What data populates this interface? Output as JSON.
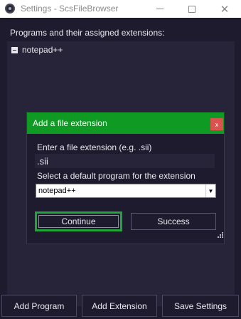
{
  "window": {
    "title": "Settings - ScsFileBrowser",
    "minimize_icon": "minimize-icon",
    "maximize_icon": "maximize-icon",
    "close_symbol": "✕"
  },
  "programs": {
    "section_label": "Programs and their assigned extensions:",
    "items": [
      {
        "label": "notepad++",
        "expanded": true
      }
    ]
  },
  "buttons": {
    "add_program": "Add Program",
    "add_extension": "Add Extension",
    "save_settings": "Save Settings"
  },
  "dialog": {
    "title": "Add a file extension",
    "close_symbol": "x",
    "header_color": "#0f9a24",
    "close_color": "#d9534f",
    "prompt_label": "Enter a file extension (e.g. .sii)",
    "extension_value": ".sii",
    "select_label": "Select a default program for the extension",
    "selected_program": "notepad++",
    "continue_label": "Continue",
    "success_label": "Success",
    "focus_color": "#21a43a"
  }
}
